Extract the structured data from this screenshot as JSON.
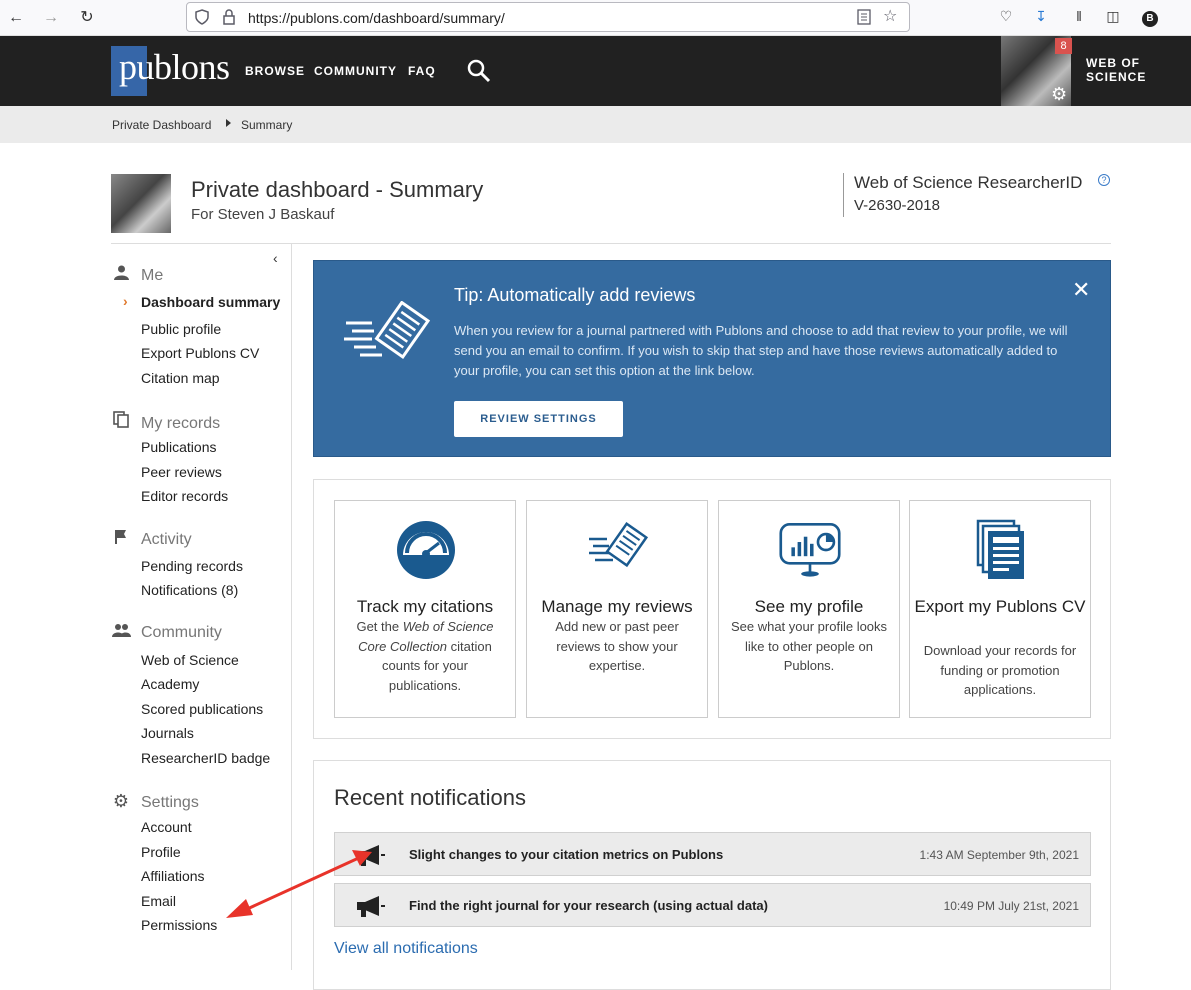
{
  "browser": {
    "url": "https://publons.com/dashboard/summary/",
    "profile_initial": "B"
  },
  "header": {
    "logo": "publons",
    "nav": [
      "BROWSE",
      "COMMUNITY",
      "FAQ"
    ],
    "notification_count": "8",
    "wos_line1": "WEB OF",
    "wos_line2": "SCIENCE"
  },
  "breadcrumb": {
    "parent": "Private Dashboard",
    "current": "Summary"
  },
  "page": {
    "title": "Private dashboard - Summary",
    "subtitle": "For Steven J Baskauf",
    "researcher_id_label": "Web of Science ResearcherID",
    "researcher_id": "V-2630-2018"
  },
  "sidebar": {
    "me": {
      "label": "Me",
      "items": [
        "Dashboard summary",
        "Public profile",
        "Export Publons CV",
        "Citation map"
      ]
    },
    "records": {
      "label": "My records",
      "items": [
        "Publications",
        "Peer reviews",
        "Editor records"
      ]
    },
    "activity": {
      "label": "Activity",
      "items": [
        "Pending records",
        "Notifications (8)"
      ]
    },
    "community": {
      "label": "Community",
      "items": [
        "Web of Science",
        "Academy",
        "Scored publications",
        "Journals",
        "ResearcherID badge"
      ]
    },
    "settings": {
      "label": "Settings",
      "items": [
        "Account",
        "Profile",
        "Affiliations",
        "Email",
        "Permissions"
      ]
    }
  },
  "tip": {
    "title": "Tip:  Automatically add reviews",
    "body": "When you review for a journal partnered with Publons and choose to add that review to your profile, we will send you an email to confirm. If you wish to skip that step and have those reviews automatically added to your profile, you can set this option at the link below.",
    "button": "REVIEW SETTINGS"
  },
  "cards": [
    {
      "title": "Track my citations",
      "desc_pre": "Get the ",
      "desc_em": "Web of Science Core Collection",
      "desc_post": " citation counts for your publications."
    },
    {
      "title": "Manage my reviews",
      "desc": "Add new or past peer reviews to show your expertise."
    },
    {
      "title": "See my profile",
      "desc": "See what your profile looks like to other people on Publons."
    },
    {
      "title": "Export my Publons CV",
      "desc": "Download your records for funding or promotion applications."
    }
  ],
  "notifications": {
    "title": "Recent notifications",
    "items": [
      {
        "text": "Slight changes to your citation metrics on Publons",
        "date": "1:43 AM September 9th, 2021"
      },
      {
        "text": "Find the right journal for your research (using actual data)",
        "date": "10:49 PM July 21st, 2021"
      }
    ],
    "view_all": "View all notifications"
  },
  "colors": {
    "header_bg": "#212121",
    "brand_blue": "#3666a8",
    "tip_bg": "#356ba0",
    "active_chevron": "#e07a2f",
    "annotation_arrow": "#e8332a",
    "link": "#2b6cb0"
  }
}
